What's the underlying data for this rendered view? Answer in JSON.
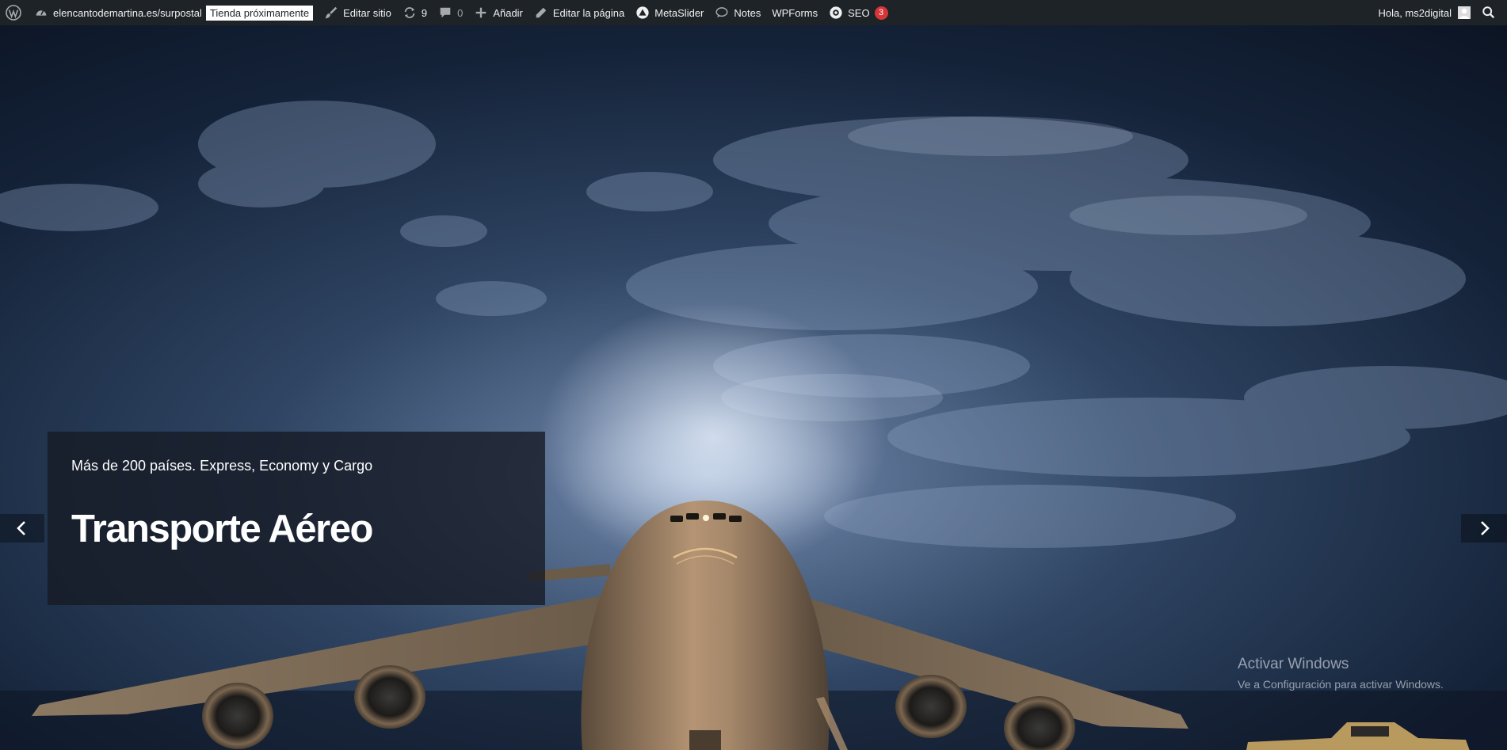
{
  "admin_bar": {
    "wp_logo_icon": "wordpress-icon",
    "site_name": "elencantodemartina.es/surpostal",
    "store_badge": "Tienda próximamente",
    "edit_site": "Editar sitio",
    "updates_count": "9",
    "comments_count": "0",
    "add_new": "Añadir",
    "edit_page": "Editar la página",
    "metaslider": "MetaSlider",
    "notes": "Notes",
    "wpforms": "WPForms",
    "seo": "SEO",
    "seo_count": "3",
    "greeting": "Hola, ms2digital"
  },
  "slide": {
    "subtitle": "Más de 200 países. Express, Economy y Cargo",
    "title": "Transporte Aéreo",
    "prev_icon": "chevron-left-icon",
    "next_icon": "chevron-right-icon"
  },
  "watermark": {
    "line1": "Activar Windows",
    "line2": "Ve a Configuración para activar Windows."
  }
}
